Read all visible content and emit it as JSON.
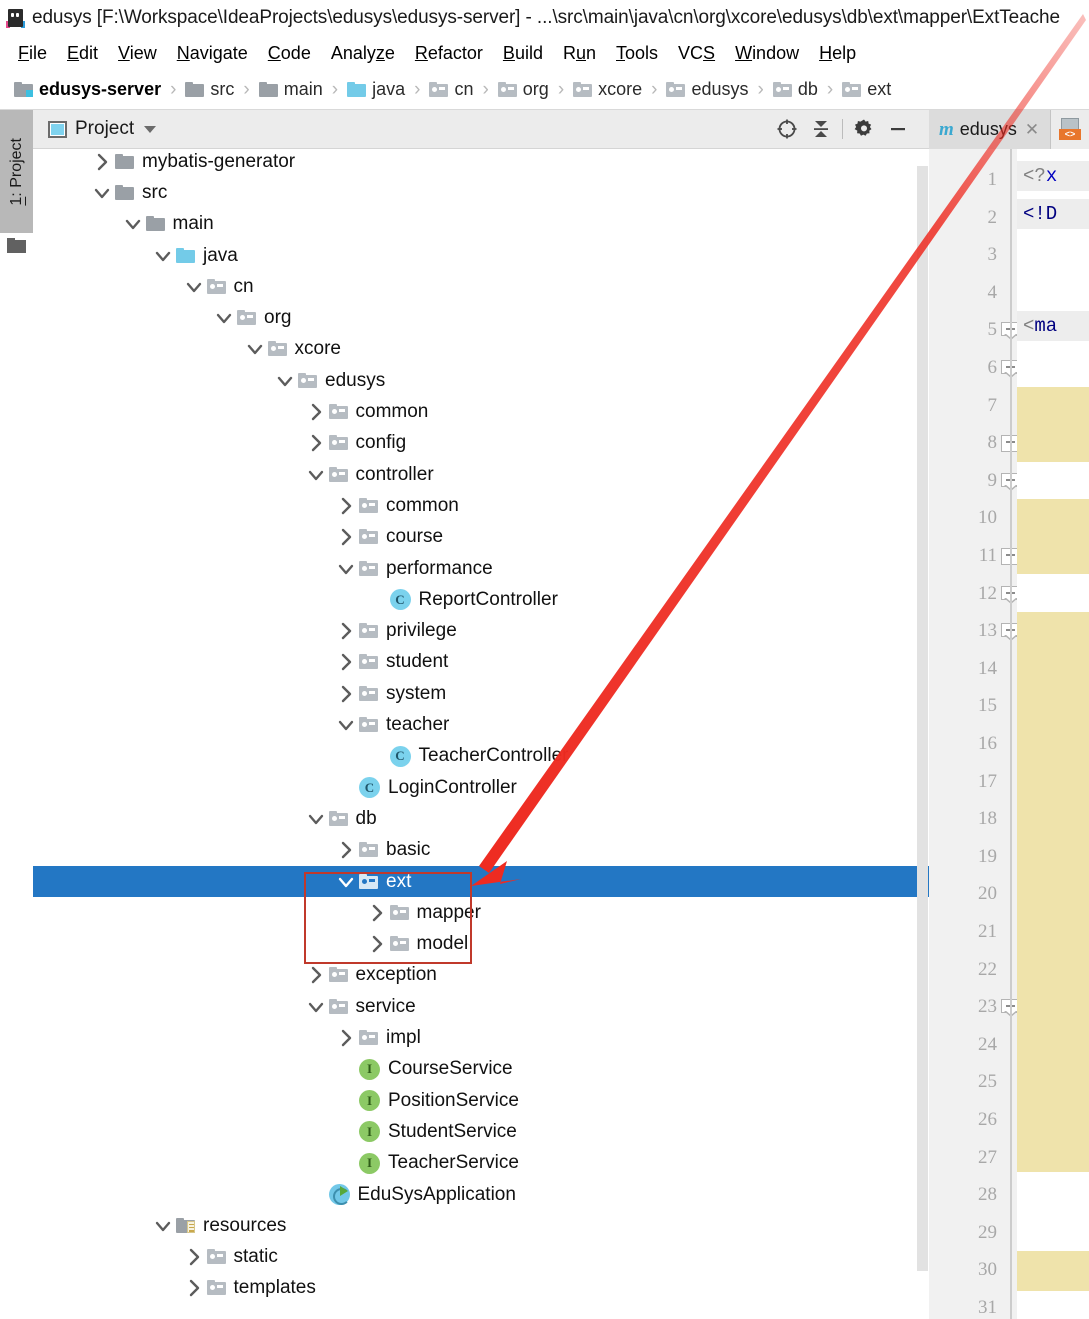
{
  "window": {
    "title": "edusys [F:\\Workspace\\IdeaProjects\\edusys\\edusys-server] - ...\\src\\main\\java\\cn\\org\\xcore\\edusys\\db\\ext\\mapper\\ExtTeache",
    "app_icon": "intellij-idea-icon"
  },
  "menubar": {
    "items": [
      {
        "label": "File",
        "mnemonic": "F"
      },
      {
        "label": "Edit",
        "mnemonic": "E"
      },
      {
        "label": "View",
        "mnemonic": "V"
      },
      {
        "label": "Navigate",
        "mnemonic": "N"
      },
      {
        "label": "Code",
        "mnemonic": "C"
      },
      {
        "label": "Analyze",
        "mnemonic": "z"
      },
      {
        "label": "Refactor",
        "mnemonic": "R"
      },
      {
        "label": "Build",
        "mnemonic": "B"
      },
      {
        "label": "Run",
        "mnemonic": "u"
      },
      {
        "label": "Tools",
        "mnemonic": "T"
      },
      {
        "label": "VCS",
        "mnemonic": "S"
      },
      {
        "label": "Window",
        "mnemonic": "W"
      },
      {
        "label": "Help",
        "mnemonic": "H"
      }
    ]
  },
  "breadcrumb": {
    "separator": "›",
    "items": [
      {
        "label": "edusys-server",
        "icon": "module-folder-icon",
        "kind": "module"
      },
      {
        "label": "src",
        "icon": "folder-icon",
        "kind": "grey"
      },
      {
        "label": "main",
        "icon": "folder-icon",
        "kind": "grey"
      },
      {
        "label": "java",
        "icon": "source-folder-icon",
        "kind": "blue"
      },
      {
        "label": "cn",
        "icon": "package-icon",
        "kind": "pkg"
      },
      {
        "label": "org",
        "icon": "package-icon",
        "kind": "pkg"
      },
      {
        "label": "xcore",
        "icon": "package-icon",
        "kind": "pkg"
      },
      {
        "label": "edusys",
        "icon": "package-icon",
        "kind": "pkg"
      },
      {
        "label": "db",
        "icon": "package-icon",
        "kind": "pkg"
      },
      {
        "label": "ext",
        "icon": "package-icon",
        "kind": "pkg"
      }
    ]
  },
  "toolstrip": {
    "button_label": "1: Project",
    "button_mnemonic": "1",
    "folder_icon": "folder-icon"
  },
  "project_panel": {
    "title": "Project",
    "view_icon": "project-view-icon",
    "dropdown_icon": "chevron-down-icon",
    "tools": [
      {
        "name": "locate-icon",
        "title": "Select Opened File"
      },
      {
        "name": "collapse-all-icon",
        "title": "Collapse All"
      },
      {
        "name": "gear-icon",
        "title": "Settings"
      },
      {
        "name": "minimize-icon",
        "title": "Hide"
      }
    ]
  },
  "tree": {
    "nodes": [
      {
        "label": "mybatis-generator",
        "depth": 1,
        "state": "collapsed",
        "icon": "folder-icon",
        "kind": "grey"
      },
      {
        "label": "src",
        "depth": 1,
        "state": "expanded",
        "icon": "folder-icon",
        "kind": "grey"
      },
      {
        "label": "main",
        "depth": 2,
        "state": "expanded",
        "icon": "folder-icon",
        "kind": "grey"
      },
      {
        "label": "java",
        "depth": 3,
        "state": "expanded",
        "icon": "source-folder-icon",
        "kind": "blue"
      },
      {
        "label": "cn",
        "depth": 4,
        "state": "expanded",
        "icon": "package-icon",
        "kind": "pkg"
      },
      {
        "label": "org",
        "depth": 5,
        "state": "expanded",
        "icon": "package-icon",
        "kind": "pkg"
      },
      {
        "label": "xcore",
        "depth": 6,
        "state": "expanded",
        "icon": "package-icon",
        "kind": "pkg"
      },
      {
        "label": "edusys",
        "depth": 7,
        "state": "expanded",
        "icon": "package-icon",
        "kind": "pkg"
      },
      {
        "label": "common",
        "depth": 8,
        "state": "collapsed",
        "icon": "package-icon",
        "kind": "pkg"
      },
      {
        "label": "config",
        "depth": 8,
        "state": "collapsed",
        "icon": "package-icon",
        "kind": "pkg"
      },
      {
        "label": "controller",
        "depth": 8,
        "state": "expanded",
        "icon": "package-icon",
        "kind": "pkg"
      },
      {
        "label": "common",
        "depth": 9,
        "state": "collapsed",
        "icon": "package-icon",
        "kind": "pkg"
      },
      {
        "label": "course",
        "depth": 9,
        "state": "collapsed",
        "icon": "package-icon",
        "kind": "pkg"
      },
      {
        "label": "performance",
        "depth": 9,
        "state": "expanded",
        "icon": "package-icon",
        "kind": "pkg"
      },
      {
        "label": "ReportController",
        "depth": 10,
        "state": "leaf",
        "icon": "class-icon",
        "kind": "class"
      },
      {
        "label": "privilege",
        "depth": 9,
        "state": "collapsed",
        "icon": "package-icon",
        "kind": "pkg"
      },
      {
        "label": "student",
        "depth": 9,
        "state": "collapsed",
        "icon": "package-icon",
        "kind": "pkg"
      },
      {
        "label": "system",
        "depth": 9,
        "state": "collapsed",
        "icon": "package-icon",
        "kind": "pkg"
      },
      {
        "label": "teacher",
        "depth": 9,
        "state": "expanded",
        "icon": "package-icon",
        "kind": "pkg"
      },
      {
        "label": "TeacherController",
        "depth": 10,
        "state": "leaf",
        "icon": "class-icon",
        "kind": "class"
      },
      {
        "label": "LoginController",
        "depth": 9,
        "state": "leaf",
        "icon": "class-icon",
        "kind": "class"
      },
      {
        "label": "db",
        "depth": 8,
        "state": "expanded",
        "icon": "package-icon",
        "kind": "pkg"
      },
      {
        "label": "basic",
        "depth": 9,
        "state": "collapsed",
        "icon": "package-icon",
        "kind": "pkg"
      },
      {
        "label": "ext",
        "depth": 9,
        "state": "expanded",
        "icon": "package-icon",
        "kind": "pkg",
        "selected": true
      },
      {
        "label": "mapper",
        "depth": 10,
        "state": "collapsed",
        "icon": "package-icon",
        "kind": "pkg"
      },
      {
        "label": "model",
        "depth": 10,
        "state": "collapsed",
        "icon": "package-icon",
        "kind": "pkg"
      },
      {
        "label": "exception",
        "depth": 8,
        "state": "collapsed",
        "icon": "package-icon",
        "kind": "pkg"
      },
      {
        "label": "service",
        "depth": 8,
        "state": "expanded",
        "icon": "package-icon",
        "kind": "pkg"
      },
      {
        "label": "impl",
        "depth": 9,
        "state": "collapsed",
        "icon": "package-icon",
        "kind": "pkg"
      },
      {
        "label": "CourseService",
        "depth": 9,
        "state": "leaf",
        "icon": "interface-icon",
        "kind": "interface"
      },
      {
        "label": "PositionService",
        "depth": 9,
        "state": "leaf",
        "icon": "interface-icon",
        "kind": "interface"
      },
      {
        "label": "StudentService",
        "depth": 9,
        "state": "leaf",
        "icon": "interface-icon",
        "kind": "interface"
      },
      {
        "label": "TeacherService",
        "depth": 9,
        "state": "leaf",
        "icon": "interface-icon",
        "kind": "interface"
      },
      {
        "label": "EduSysApplication",
        "depth": 8,
        "state": "leaf",
        "icon": "spring-boot-run-icon",
        "kind": "spring"
      },
      {
        "label": "resources",
        "depth": 3,
        "state": "expanded",
        "icon": "resource-folder-icon",
        "kind": "res"
      },
      {
        "label": "static",
        "depth": 4,
        "state": "collapsed",
        "icon": "package-icon",
        "kind": "pkg"
      },
      {
        "label": "templates",
        "depth": 4,
        "state": "collapsed",
        "icon": "package-icon",
        "kind": "pkg"
      }
    ]
  },
  "editor": {
    "tab": {
      "label": "edusys",
      "icon": "maven-module-icon",
      "icon_letter": "m",
      "close_icon": "close-icon"
    },
    "extra_icon": "xml-file-icon",
    "extra_icon_label": "<>",
    "line_numbers": [
      1,
      2,
      3,
      4,
      5,
      6,
      7,
      8,
      9,
      10,
      11,
      12,
      13,
      14,
      15,
      16,
      17,
      18,
      19,
      20,
      21,
      22,
      23,
      24,
      25,
      26,
      27,
      28,
      29,
      30,
      31
    ],
    "visible_code": [
      {
        "line": 1,
        "text": "<?x",
        "style": "grey-hl"
      },
      {
        "line": 2,
        "text": "<!D",
        "style": "grey-hl"
      },
      {
        "line": 5,
        "text": "<ma",
        "style": "grey-hl"
      }
    ],
    "fold_lines": [
      5,
      6,
      8,
      9,
      11,
      12,
      13,
      23
    ]
  },
  "annotation": {
    "box_color": "#c0392b",
    "arrow_color": "#ee2b21",
    "arrow_note": "red arrow pointing from top-right of window to the ext package node"
  },
  "colors": {
    "selection_blue": "#2377c4",
    "panel_header": "#ececec",
    "gutter": "#f1f1f1",
    "fold_highlight": "#efe3ab",
    "code_highlight": "#ededed"
  }
}
